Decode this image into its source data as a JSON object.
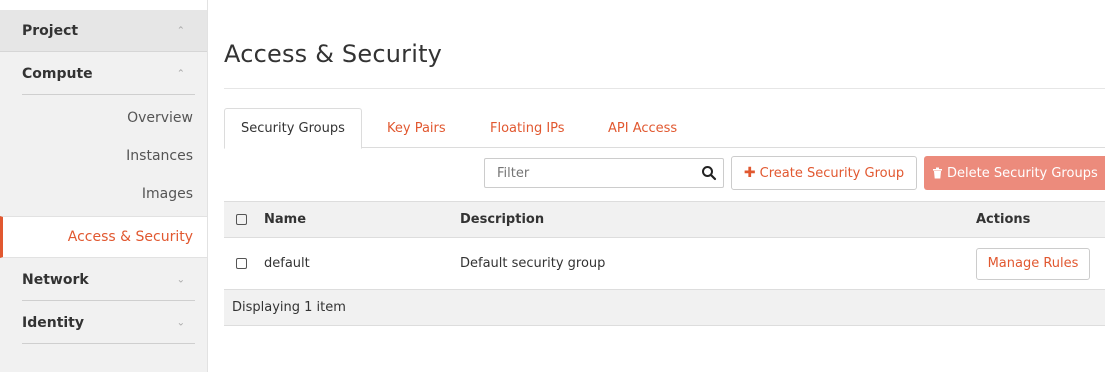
{
  "sidebar": {
    "project": {
      "label": "Project"
    },
    "compute": {
      "label": "Compute"
    },
    "items": [
      {
        "label": "Overview"
      },
      {
        "label": "Instances"
      },
      {
        "label": "Images"
      },
      {
        "label": "Access & Security"
      }
    ],
    "network": {
      "label": "Network"
    },
    "identity": {
      "label": "Identity"
    }
  },
  "page": {
    "title": "Access & Security"
  },
  "tabs": [
    {
      "label": "Security Groups"
    },
    {
      "label": "Key Pairs"
    },
    {
      "label": "Floating IPs"
    },
    {
      "label": "API Access"
    }
  ],
  "toolbar": {
    "filter_placeholder": "Filter",
    "create_label": "Create Security Group",
    "delete_label": "Delete Security Groups"
  },
  "table": {
    "headers": {
      "name": "Name",
      "description": "Description",
      "actions": "Actions"
    },
    "rows": [
      {
        "name": "default",
        "description": "Default security group",
        "action": "Manage Rules"
      }
    ],
    "footer": "Displaying 1 item"
  },
  "colors": {
    "accent": "#e15830",
    "danger": "#ec8b7c"
  }
}
